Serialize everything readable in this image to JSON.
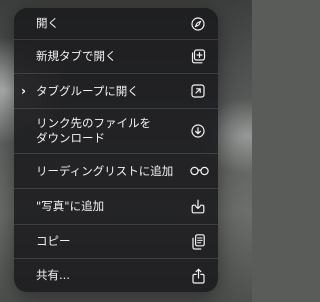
{
  "menu": {
    "items": [
      {
        "label": "開く",
        "icon": "compass-icon",
        "has_submenu": false
      },
      {
        "label": "新規タブで開く",
        "icon": "new-tab-icon",
        "has_submenu": false
      },
      {
        "label": "タブグループに開く",
        "icon": "tab-group-icon",
        "has_submenu": true
      },
      {
        "label": "リンク先のファイルを\nダウンロード",
        "icon": "download-icon",
        "has_submenu": false
      },
      {
        "label": "リーディングリストに追加",
        "icon": "glasses-icon",
        "has_submenu": false
      },
      {
        "label": "\"写真\"に追加",
        "icon": "save-to-photos-icon",
        "has_submenu": false
      },
      {
        "label": "コピー",
        "icon": "copy-icon",
        "has_submenu": false
      },
      {
        "label": "共有...",
        "icon": "share-icon",
        "has_submenu": false
      }
    ],
    "submenu_chevron": "›"
  }
}
